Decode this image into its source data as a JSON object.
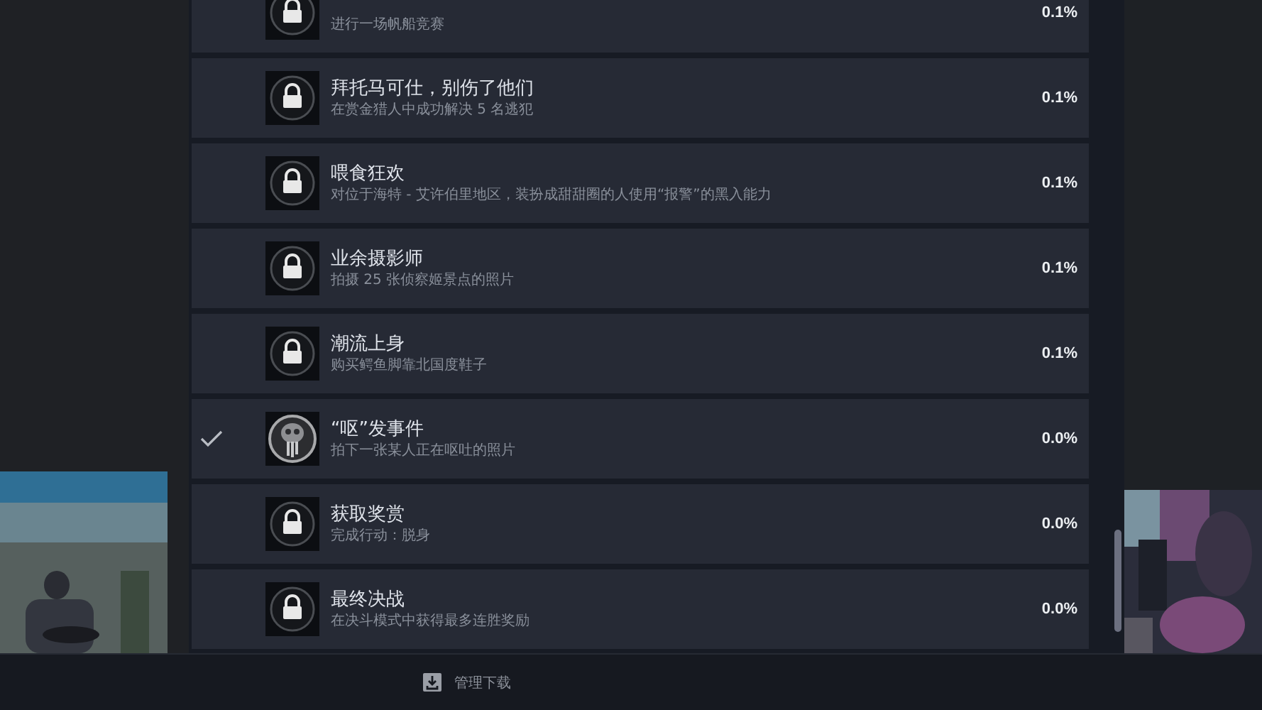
{
  "achievements": [
    {
      "description": "进行一场帆船竞赛",
      "percent": "0.1%",
      "achieved": false
    },
    {
      "title": "拜托马可仕，别伤了他们",
      "description": "在赏金猎人中成功解决 5 名逃犯",
      "percent": "0.1%",
      "achieved": false
    },
    {
      "title": "喂食狂欢",
      "description": "对位于海特 - 艾许伯里地区，装扮成甜甜圈的人使用“报警”的黑入能力",
      "percent": "0.1%",
      "achieved": false
    },
    {
      "title": "业余摄影师",
      "description": "拍摄 25 张侦察姬景点的照片",
      "percent": "0.1%",
      "achieved": false
    },
    {
      "title": "潮流上身",
      "description": "购买鳄鱼脚靠北国度鞋子",
      "percent": "0.1%",
      "achieved": false
    },
    {
      "title": "“呕”发事件",
      "description": "拍下一张某人正在呕吐的照片",
      "percent": "0.0%",
      "achieved": true
    },
    {
      "title": "获取奖赏",
      "description": "完成行动：脱身",
      "percent": "0.0%",
      "achieved": false
    },
    {
      "title": "最终决战",
      "description": "在决斗模式中获得最多连胜奖励",
      "percent": "0.0%",
      "achieved": false
    }
  ],
  "footer": {
    "label": "管理下载"
  }
}
